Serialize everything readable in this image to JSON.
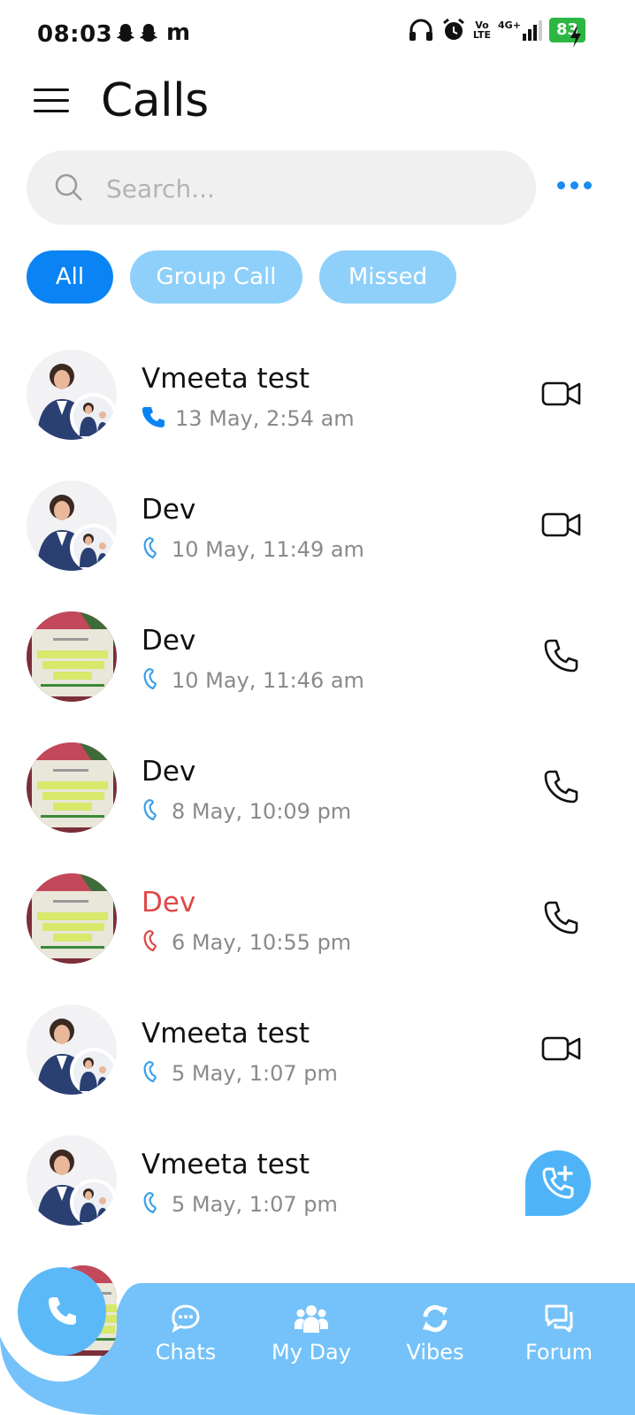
{
  "status_bar": {
    "time": "08:03",
    "notification_letter": "m",
    "volte": "Vo LTE",
    "network": "4G+",
    "battery": "83"
  },
  "header": {
    "title": "Calls"
  },
  "search": {
    "placeholder": "Search..."
  },
  "filters": [
    {
      "label": "All",
      "active": true
    },
    {
      "label": "Group Call",
      "active": false
    },
    {
      "label": "Missed",
      "active": false
    }
  ],
  "calls": [
    {
      "name": "Vmeeta test",
      "time": "13 May, 2:54 am",
      "status": "incoming",
      "type": "video",
      "avatar": "group"
    },
    {
      "name": "Dev",
      "time": "10 May, 11:49 am",
      "status": "outgoing",
      "type": "video",
      "avatar": "group"
    },
    {
      "name": "Dev",
      "time": "10 May, 11:46 am",
      "status": "outgoing",
      "type": "audio",
      "avatar": "book"
    },
    {
      "name": "Dev",
      "time": "8 May, 10:09 pm",
      "status": "outgoing",
      "type": "audio",
      "avatar": "book"
    },
    {
      "name": "Dev",
      "time": "6 May, 10:55 pm",
      "status": "missed",
      "type": "audio",
      "avatar": "book"
    },
    {
      "name": "Vmeeta test",
      "time": "5 May, 1:07 pm",
      "status": "outgoing",
      "type": "video",
      "avatar": "group"
    },
    {
      "name": "Vmeeta test",
      "time": "5 May, 1:07 pm",
      "status": "outgoing",
      "type": "audio",
      "avatar": "group"
    }
  ],
  "bottom_nav": {
    "items": [
      {
        "label": "Chats",
        "icon": "chat-bubble-icon"
      },
      {
        "label": "My Day",
        "icon": "people-icon"
      },
      {
        "label": "Vibes",
        "icon": "refresh-icon"
      },
      {
        "label": "Forum",
        "icon": "forum-icon"
      }
    ]
  },
  "colors": {
    "accent": "#0a84f5",
    "chip_inactive": "#8fd0fa",
    "nav_bg": "#74c2f9",
    "missed": "#e04848"
  }
}
